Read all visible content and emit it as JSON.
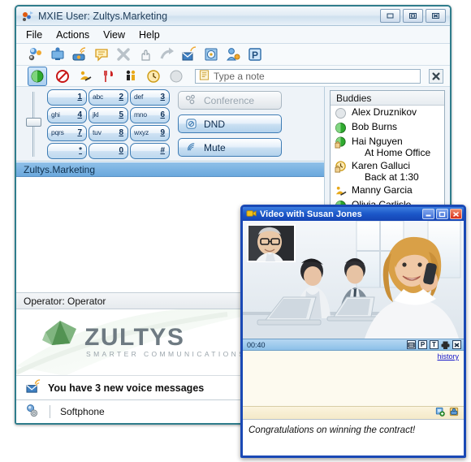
{
  "main_window": {
    "title": "MXIE User: Zultys.Marketing",
    "icon": "mxie-app-icon",
    "title_buttons": [
      {
        "name": "minimize-button",
        "glyph": "▬"
      },
      {
        "name": "maximize-button",
        "glyph": "❐"
      },
      {
        "name": "close-button",
        "glyph": "✕"
      }
    ],
    "menu": [
      "File",
      "Actions",
      "View",
      "Help"
    ],
    "toolbar_icons": [
      "contacts-icon",
      "user-screen-icon",
      "phone-ring-icon",
      "chat-bubble-icon",
      "hangup-x-icon",
      "hold-hand-icon",
      "transfer-arrow-icon",
      "voicemail-icon",
      "recording-icon",
      "transfer-user-icon",
      "park-icon"
    ],
    "presence": {
      "selected": "available",
      "options": [
        "available",
        "do-not-disturb",
        "at-work",
        "lunch",
        "away",
        "be-right-back",
        "offline"
      ]
    },
    "note": {
      "value": "",
      "placeholder": "Type a note",
      "icon": "note-icon",
      "clear_label": "✖"
    },
    "dialpad": {
      "volume_label": "volume-slider",
      "keys": [
        {
          "letters": "",
          "digit": "1"
        },
        {
          "letters": "abc",
          "digit": "2"
        },
        {
          "letters": "def",
          "digit": "3"
        },
        {
          "letters": "ghi",
          "digit": "4"
        },
        {
          "letters": "jkl",
          "digit": "5"
        },
        {
          "letters": "mno",
          "digit": "6"
        },
        {
          "letters": "pqrs",
          "digit": "7"
        },
        {
          "letters": "tuv",
          "digit": "8"
        },
        {
          "letters": "wxyz",
          "digit": "9"
        },
        {
          "letters": "",
          "digit": "*"
        },
        {
          "letters": "",
          "digit": "0"
        },
        {
          "letters": "",
          "digit": "#"
        }
      ]
    },
    "call_actions": [
      {
        "label": "Conference",
        "accel": "C",
        "icon": "conference-icon",
        "enabled": false
      },
      {
        "label": "DND",
        "accel": "D",
        "icon": "dnd-icon",
        "enabled": true
      },
      {
        "label": "Mute",
        "accel": "M",
        "icon": "mute-icon",
        "enabled": true
      }
    ],
    "session_header": "Zultys.Marketing",
    "operator_bar": "Operator: Operator",
    "brand": {
      "name": "ZULTYS",
      "tagline": "SMARTER COMMUNICATIONS"
    },
    "voicemail_notice": "You have 3 new voice messages",
    "voicemail_icon": "voicemail-envelope-icon",
    "softphone_label": "Softphone",
    "softphone_icon": "softphone-gear-icon"
  },
  "buddies": {
    "header": "Buddies",
    "items": [
      {
        "name": "Alex Druznikov",
        "status": "offline",
        "note": ""
      },
      {
        "name": "Bob Burns",
        "status": "available",
        "note": ""
      },
      {
        "name": "Hai Nguyen",
        "status": "at-home-office",
        "note": "At Home Office"
      },
      {
        "name": "Karen Galluci",
        "status": "be-right-back",
        "note": "Back at 1:30"
      },
      {
        "name": "Manny Garcia",
        "status": "at-work",
        "note": ""
      },
      {
        "name": "Olivia Carlisle",
        "status": "available",
        "note": ""
      }
    ]
  },
  "video_window": {
    "title": "Video with Susan Jones",
    "icon": "video-call-icon",
    "title_buttons": [
      {
        "name": "minimize-button",
        "glyph": "▬"
      },
      {
        "name": "maximize-button",
        "glyph": "❐"
      },
      {
        "name": "close-button",
        "glyph": "✕"
      }
    ],
    "video": {
      "remote_caption": "woman-on-phone-video",
      "pip_caption": "self-view-man-video"
    },
    "timer": "00:40",
    "toolbar_icons": [
      {
        "name": "screen-share-icon",
        "glyph": "▤"
      },
      {
        "name": "park-icon",
        "glyph": "P"
      },
      {
        "name": "text-chat-icon",
        "glyph": "T"
      },
      {
        "name": "print-icon",
        "glyph": "▄"
      },
      {
        "name": "end-call-icon",
        "glyph": "✕"
      }
    ],
    "history_link": "history",
    "action_icons": [
      {
        "name": "attach-file-icon"
      },
      {
        "name": "call-contact-icon"
      }
    ],
    "message": "Congratulations on winning the contract!"
  },
  "colors": {
    "accent_blue": "#1b57c8",
    "frame_teal": "#2f7d8c",
    "session_header": "#6aa8dd",
    "presence_green": "#2faa2f",
    "link_blue": "#1313c8"
  }
}
